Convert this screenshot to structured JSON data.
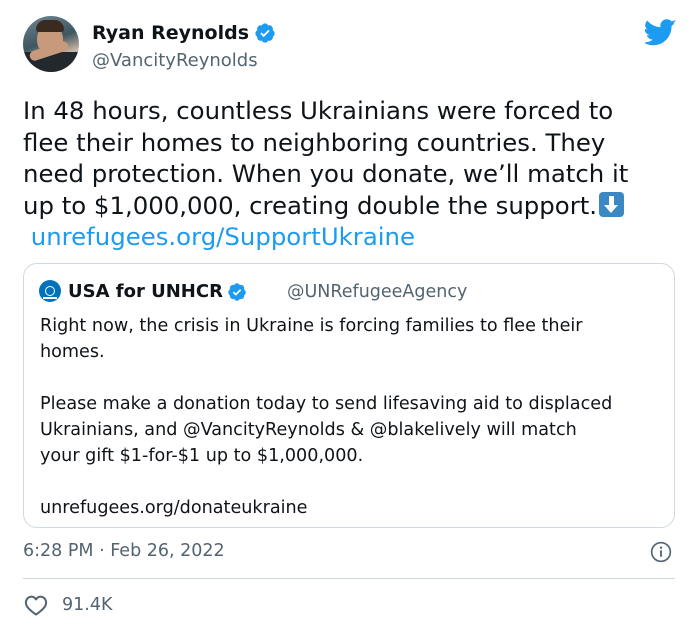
{
  "author": {
    "display_name": "Ryan Reynolds",
    "handle": "@VancityReynolds"
  },
  "tweet": {
    "lines": [
      "In 48 hours, countless Ukrainians were forced to",
      "flee their homes to neighboring countries. They",
      "need protection. When you donate, we’ll match it",
      "up to $1,000,000, creating double the support."
    ],
    "emoji": "down-arrow-emoji",
    "link": "unrefugees.org/SupportUkraine"
  },
  "quoted_tweet": {
    "display_name": "USA for UNHCR",
    "handle": "@UNRefugeeAgency",
    "paragraph1": [
      "Right now, the crisis in Ukraine is forcing families to flee their",
      "homes."
    ],
    "paragraph2": [
      "Please make a donation today to send lifesaving aid to displaced",
      "Ukrainians, and @VancityReynolds & @blakelively will match",
      "your gift $1-for-$1 up to $1,000,000."
    ],
    "paragraph3": [
      "unrefugees.org/donateukraine"
    ]
  },
  "meta": {
    "timestamp": "6:28 PM · Feb 26, 2022",
    "likes": "91.4K"
  },
  "colors": {
    "accent": "#1d9bf0",
    "text": "#0f1419",
    "secondary": "#536471",
    "border": "#cfd9de"
  },
  "icons": [
    "verified-badge-icon",
    "twitter-bird-icon",
    "info-icon",
    "heart-icon"
  ]
}
